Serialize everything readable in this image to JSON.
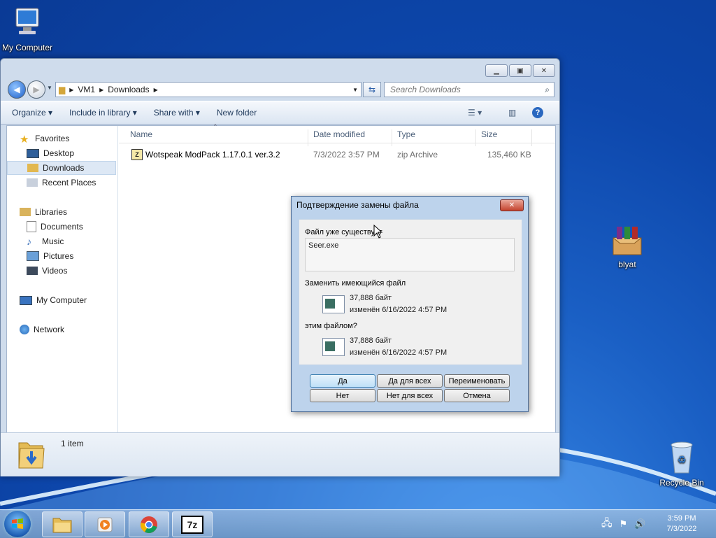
{
  "desktop": {
    "icons": [
      {
        "label": "My Computer"
      },
      {
        "label": "blyat"
      },
      {
        "label": "Recycle Bin"
      }
    ]
  },
  "explorer": {
    "breadcrumb": [
      "VM1",
      "Downloads"
    ],
    "search_placeholder": "Search Downloads",
    "commands": [
      "Organize",
      "Include in library",
      "Share with",
      "New folder"
    ],
    "nav": {
      "favorites": {
        "label": "Favorites",
        "items": [
          "Desktop",
          "Downloads",
          "Recent Places"
        ]
      },
      "libraries": {
        "label": "Libraries",
        "items": [
          "Documents",
          "Music",
          "Pictures",
          "Videos"
        ]
      },
      "computer": "My Computer",
      "network": "Network"
    },
    "columns": [
      "Name",
      "Date modified",
      "Type",
      "Size"
    ],
    "files": [
      {
        "name": "Wotspeak ModPack 1.17.0.1 ver.3.2",
        "date": "7/3/2022 3:57 PM",
        "type": "zip Archive",
        "size": "135,460 KB"
      }
    ],
    "status": "1 item"
  },
  "dialog": {
    "title": "Подтверждение замены файла",
    "exists_label": "Файл уже существует",
    "filename": "Seer.exe",
    "replace_label": "Заменить имеющийся файл",
    "existing": {
      "size": "37,888 байт",
      "modified": "изменён 6/16/2022 4:57 PM"
    },
    "with_label": "этим файлом?",
    "new": {
      "size": "37,888 байт",
      "modified": "изменён 6/16/2022 4:57 PM"
    },
    "buttons": {
      "yes": "Да",
      "yes_all": "Да для всех",
      "rename": "Переименовать",
      "no": "Нет",
      "no_all": "Нет для всех",
      "cancel": "Отмена"
    }
  },
  "taskbar": {
    "time": "3:59 PM",
    "date": "7/3/2022"
  }
}
